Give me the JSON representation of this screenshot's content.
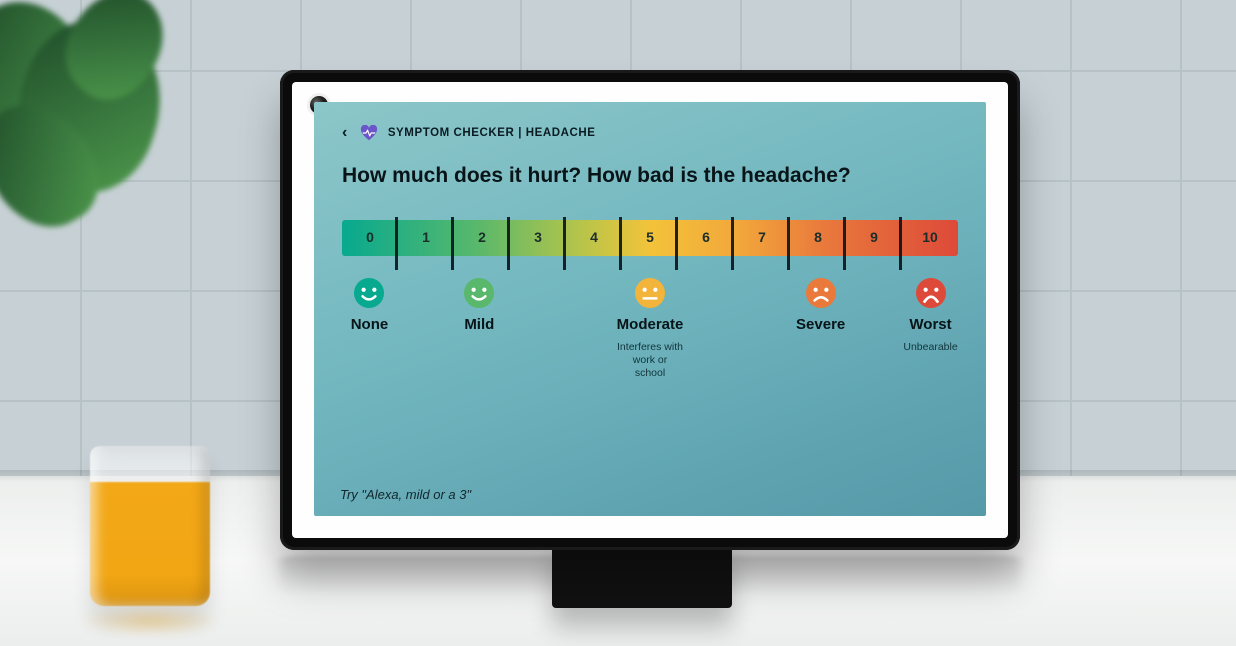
{
  "header": {
    "app_name": "SYMPTOM CHECKER",
    "separator": " | ",
    "context": "HEADACHE"
  },
  "question": "How much does it hurt? How bad is the headache?",
  "scale": {
    "values": [
      "0",
      "1",
      "2",
      "3",
      "4",
      "5",
      "6",
      "7",
      "8",
      "9",
      "10"
    ]
  },
  "levels": [
    {
      "pos": 0,
      "label": "None",
      "sub": "",
      "face": "happy",
      "color": "#07a98f"
    },
    {
      "pos": 2,
      "label": "Mild",
      "sub": "",
      "face": "happy",
      "color": "#59b86b"
    },
    {
      "pos": 5,
      "label": "Moderate",
      "sub": "Interferes with work or school",
      "face": "neutral",
      "color": "#f2b43a"
    },
    {
      "pos": 8,
      "label": "Severe",
      "sub": "",
      "face": "sad",
      "color": "#e97a3c"
    },
    {
      "pos": 10,
      "label": "Worst",
      "sub": "Unbearable",
      "face": "worst",
      "color": "#dd4a39"
    }
  ],
  "hint": "Try \"Alexa, mild or a 3\""
}
